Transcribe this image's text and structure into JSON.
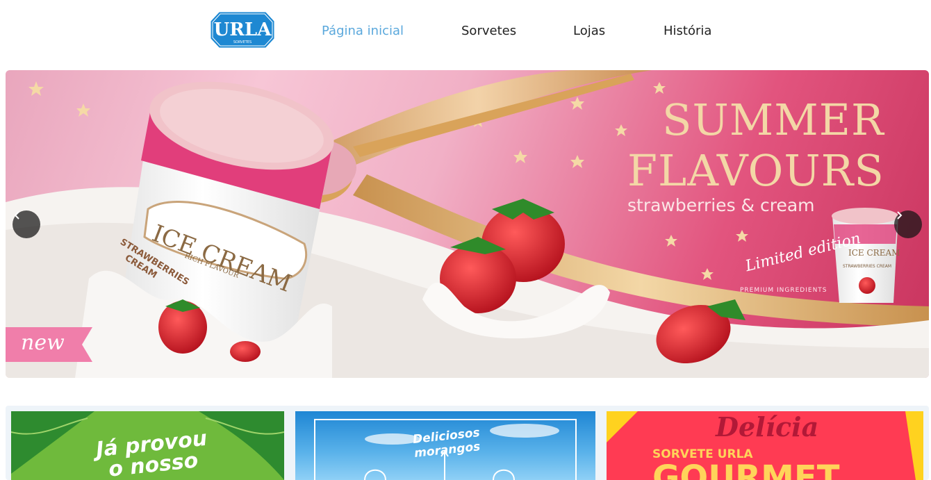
{
  "nav": {
    "logo_text": "URLA",
    "logo_sub": "SORVETES",
    "items": [
      {
        "label": "Página inicial",
        "active": true
      },
      {
        "label": "Sorvetes",
        "active": false
      },
      {
        "label": "Lojas",
        "active": false
      },
      {
        "label": "História",
        "active": false
      }
    ],
    "active_color": "#5aa8dc",
    "logo_color": "#1e88d2"
  },
  "hero": {
    "title_line1": "SUMMER",
    "title_line2": "FLAVOURS",
    "subtitle": "strawberries & cream",
    "limited": "Limited edition",
    "premium": "PREMIUM INGREDIENTS",
    "cup_brand": "ICE CREAM",
    "cup_rich": "RICH FLAVOUR",
    "cup_flavour_1": "STRAWBERRIES",
    "cup_flavour_2": "CREAM",
    "mini_cup_brand": "ICE CREAM",
    "mini_cup_flavour": "STRAWBERRIES CREAM",
    "badge": "new",
    "prev_icon": "chevron-left-icon",
    "next_icon": "chevron-right-icon"
  },
  "promos": [
    {
      "line1": "Já provou",
      "line2": "o nosso"
    },
    {
      "line1": "Deliciosos",
      "line2": "morangos"
    },
    {
      "title": "Delícia",
      "subtitle": "SORVETE URLA",
      "big": "GOURMET"
    }
  ]
}
